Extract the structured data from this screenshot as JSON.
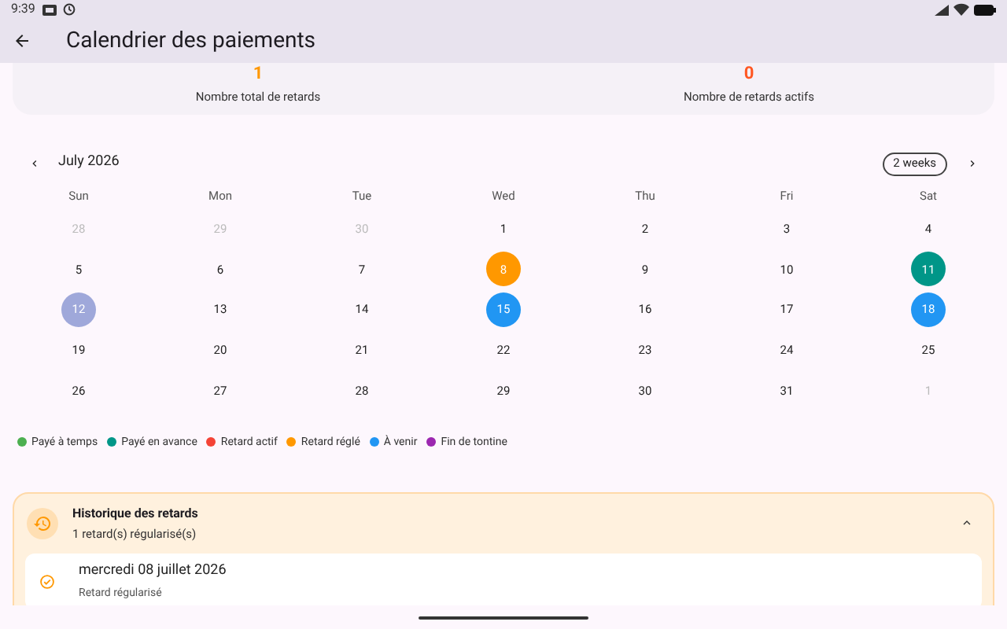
{
  "status_bar": {
    "time": "9:39"
  },
  "app_bar": {
    "title": "Calendrier des paiements"
  },
  "stats": [
    {
      "value": "1",
      "label": "Nombre total de retards",
      "color": "#ff9800"
    },
    {
      "value": "0",
      "label": "Nombre de retards actifs",
      "color": "#ff5722"
    }
  ],
  "calendar": {
    "month": "July 2026",
    "format_button": "2 weeks",
    "weekdays": [
      "Sun",
      "Mon",
      "Tue",
      "Wed",
      "Thu",
      "Fri",
      "Sat"
    ],
    "weeks": [
      [
        {
          "day": "28",
          "outside": true
        },
        {
          "day": "29",
          "outside": true
        },
        {
          "day": "30",
          "outside": true
        },
        {
          "day": "1",
          "outside": false
        },
        {
          "day": "2",
          "outside": false
        },
        {
          "day": "3",
          "outside": false
        },
        {
          "day": "4",
          "outside": false
        }
      ],
      [
        {
          "day": "5",
          "outside": false
        },
        {
          "day": "6",
          "outside": false
        },
        {
          "day": "7",
          "outside": false
        },
        {
          "day": "8",
          "outside": false,
          "color": "#ff9800"
        },
        {
          "day": "9",
          "outside": false
        },
        {
          "day": "10",
          "outside": false
        },
        {
          "day": "11",
          "outside": false,
          "color": "#009688"
        }
      ],
      [
        {
          "day": "12",
          "outside": false,
          "color": "#9fa8da"
        },
        {
          "day": "13",
          "outside": false
        },
        {
          "day": "14",
          "outside": false
        },
        {
          "day": "15",
          "outside": false,
          "color": "#2196f3"
        },
        {
          "day": "16",
          "outside": false
        },
        {
          "day": "17",
          "outside": false
        },
        {
          "day": "18",
          "outside": false,
          "color": "#2196f3"
        }
      ],
      [
        {
          "day": "19",
          "outside": false
        },
        {
          "day": "20",
          "outside": false
        },
        {
          "day": "21",
          "outside": false
        },
        {
          "day": "22",
          "outside": false
        },
        {
          "day": "23",
          "outside": false
        },
        {
          "day": "24",
          "outside": false
        },
        {
          "day": "25",
          "outside": false
        }
      ],
      [
        {
          "day": "26",
          "outside": false
        },
        {
          "day": "27",
          "outside": false
        },
        {
          "day": "28",
          "outside": false
        },
        {
          "day": "29",
          "outside": false
        },
        {
          "day": "30",
          "outside": false
        },
        {
          "day": "31",
          "outside": false
        },
        {
          "day": "1",
          "outside": true
        }
      ]
    ]
  },
  "legend": [
    {
      "label": "Payé à temps",
      "color": "#4caf50"
    },
    {
      "label": "Payé en avance",
      "color": "#009688"
    },
    {
      "label": "Retard actif",
      "color": "#f44336"
    },
    {
      "label": "Retard réglé",
      "color": "#ff9800"
    },
    {
      "label": "À venir",
      "color": "#2196f3"
    },
    {
      "label": "Fin de tontine",
      "color": "#9c27b0"
    }
  ],
  "history": {
    "title": "Historique des retards",
    "subtitle": "1 retard(s) régularisé(s)",
    "expanded": true,
    "items": [
      {
        "date": "mercredi 08 juillet 2026",
        "status": "Retard régularisé"
      }
    ]
  }
}
